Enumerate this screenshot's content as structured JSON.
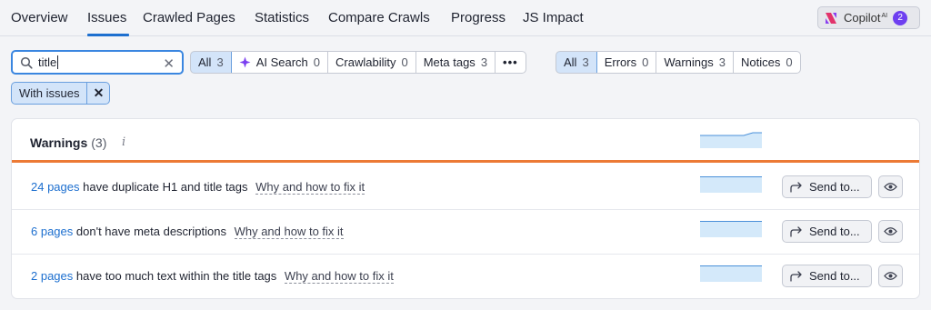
{
  "nav": {
    "tabs": [
      "Overview",
      "Issues",
      "Crawled Pages",
      "Statistics",
      "Compare Crawls",
      "Progress",
      "JS Impact"
    ],
    "active": "Issues",
    "copilot": {
      "label": "Copilot",
      "sup": "AI",
      "badge": "2",
      "badge_color": "#6e3ff0"
    }
  },
  "search": {
    "value": "title",
    "icon": "search-icon",
    "clear_icon": "close-icon"
  },
  "category_filter": {
    "items": [
      {
        "label": "All",
        "count": "3",
        "selected": true
      },
      {
        "label": "AI Search",
        "count": "0",
        "icon": "sparkle-icon"
      },
      {
        "label": "Crawlability",
        "count": "0"
      },
      {
        "label": "Meta tags",
        "count": "3"
      },
      {
        "label": "•••",
        "count": ""
      }
    ]
  },
  "type_filter": {
    "items": [
      {
        "label": "All",
        "count": "3",
        "selected": true
      },
      {
        "label": "Errors",
        "count": "0"
      },
      {
        "label": "Warnings",
        "count": "3"
      },
      {
        "label": "Notices",
        "count": "0"
      }
    ]
  },
  "active_chip": {
    "label": "With issues",
    "remove_icon": "close-icon"
  },
  "panel": {
    "title": "Warnings",
    "count": "(3)",
    "info_icon": "info-icon",
    "accent_color": "#ec7a35",
    "rows": [
      {
        "link": "24 pages",
        "text": "have duplicate H1 and title tags",
        "why": "Why and how to fix it",
        "send": "Send to..."
      },
      {
        "link": "6 pages",
        "text": "don't have meta descriptions",
        "why": "Why and how to fix it",
        "send": "Send to..."
      },
      {
        "link": "2 pages",
        "text": "have too much text within the title tags",
        "why": "Why and how to fix it",
        "send": "Send to..."
      }
    ]
  }
}
